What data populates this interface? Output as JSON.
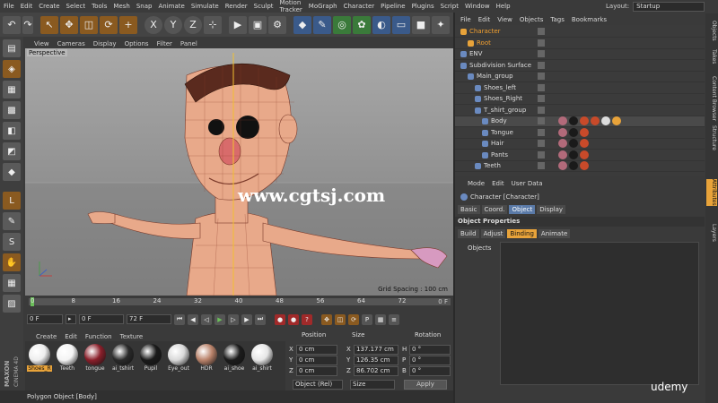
{
  "menu": [
    "File",
    "Edit",
    "Create",
    "Select",
    "Tools",
    "Mesh",
    "Snap",
    "Animate",
    "Simulate",
    "Render",
    "Sculpt",
    "Motion Tracker",
    "MoGraph",
    "Character",
    "Pipeline",
    "Plugins",
    "Script",
    "Window",
    "Help"
  ],
  "layout": {
    "label": "Layout:",
    "value": "Startup"
  },
  "toolbar": {
    "x": "X",
    "y": "Y",
    "z": "Z"
  },
  "viewport": {
    "menu": [
      "View",
      "Cameras",
      "Display",
      "Options",
      "Filter",
      "Panel"
    ],
    "label": "Perspective",
    "grid_spacing": "Grid Spacing : 100 cm"
  },
  "watermark": "www.cgtsj.com",
  "timeline": {
    "ticks": [
      "0",
      "8",
      "16",
      "24",
      "32",
      "40",
      "48",
      "56",
      "64",
      "72"
    ],
    "end_label": "0 F",
    "start_field": "0 F",
    "min_field": "0 F",
    "max_field": "72 F",
    "end_field": "72 F"
  },
  "material": {
    "menu": [
      "Create",
      "Edit",
      "Function",
      "Texture"
    ],
    "items": [
      {
        "label": "Shoes_R",
        "color": "#eeeeee"
      },
      {
        "label": "Teeth",
        "color": "#f4f4f4"
      },
      {
        "label": "tongue",
        "color": "#8a1f2a"
      },
      {
        "label": "ai_tshirt",
        "color": "#2a2a2a"
      },
      {
        "label": "Pupil",
        "color": "#1a1a1a"
      },
      {
        "label": "Eye_out",
        "color": "#d9d9d9"
      },
      {
        "label": "HDR",
        "color": "#b9826a"
      },
      {
        "label": "ai_shoe",
        "color": "#1c1c1c"
      },
      {
        "label": "ai_shirt",
        "color": "#e6e6e6"
      }
    ]
  },
  "coords": {
    "headers": {
      "position": "Position",
      "size": "Size",
      "rotation": "Rotation"
    },
    "rows": [
      {
        "axis": "X",
        "pos": "0 cm",
        "size_axis": "X",
        "size": "137.177 cm",
        "rot_axis": "H",
        "rot": "0 °"
      },
      {
        "axis": "Y",
        "pos": "0 cm",
        "size_axis": "Y",
        "size": "126.35 cm",
        "rot_axis": "P",
        "rot": "0 °"
      },
      {
        "axis": "Z",
        "pos": "0 cm",
        "size_axis": "Z",
        "size": "86.702 cm",
        "rot_axis": "B",
        "rot": "0 °"
      }
    ],
    "mode": "Object (Rel)",
    "size_mode": "Size",
    "apply": "Apply"
  },
  "status": "Polygon Object [Body]",
  "brand": {
    "maxon": "MAXON",
    "c4d": "CINEMA 4D",
    "udemy": "udemy"
  },
  "object_manager": {
    "menu": [
      "File",
      "Edit",
      "View",
      "Objects",
      "Tags",
      "Bookmarks"
    ],
    "objects": [
      {
        "name": "Character",
        "indent": 0,
        "orange": true
      },
      {
        "name": "Root",
        "indent": 1,
        "orange": true
      },
      {
        "name": "ENV",
        "indent": 0,
        "orange": false
      },
      {
        "name": "Subdivision Surface",
        "indent": 0,
        "orange": false
      },
      {
        "name": "Main_group",
        "indent": 1,
        "orange": false
      },
      {
        "name": "Shoes_left",
        "indent": 2,
        "orange": false
      },
      {
        "name": "Shoes_Right",
        "indent": 2,
        "orange": false
      },
      {
        "name": "T_shirt_group",
        "indent": 2,
        "orange": false
      },
      {
        "name": "Body",
        "indent": 3,
        "orange": false
      },
      {
        "name": "Tongue",
        "indent": 3,
        "orange": false
      },
      {
        "name": "Hair",
        "indent": 3,
        "orange": false
      },
      {
        "name": "Pants",
        "indent": 3,
        "orange": false
      },
      {
        "name": "Teeth",
        "indent": 2,
        "orange": false
      }
    ]
  },
  "attributes": {
    "menu": [
      "Mode",
      "Edit",
      "User Data"
    ],
    "title": "Character [Character]",
    "tabs1": [
      "Basic",
      "Coord.",
      "Object",
      "Display"
    ],
    "active_tab1": "Object",
    "section": "Object Properties",
    "tabs2": [
      "Build",
      "Adjust",
      "Binding",
      "Animate"
    ],
    "active_tab2": "Binding",
    "objects_label": "Objects"
  },
  "side_tabs": [
    "Objects",
    "Takes",
    "Content Browser",
    "Structure",
    "Attributes",
    "Layers"
  ],
  "active_side_tab": "Attributes"
}
